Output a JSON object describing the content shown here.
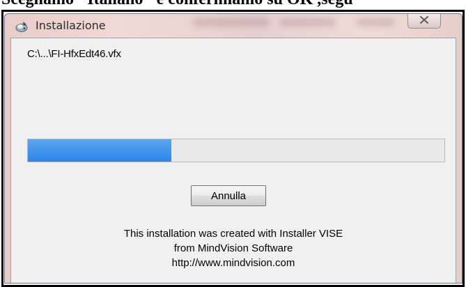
{
  "document": {
    "heading_fragment": "Scegliamo \"Italiano\" e confermiamo su OK ,segu"
  },
  "window": {
    "title": "Installazione",
    "app_icon": "installer-icon",
    "close_icon": "close-icon"
  },
  "install": {
    "current_file": "C:\\...\\FI-HfxEdt46.vfx",
    "progress_fraction": 0.345
  },
  "buttons": {
    "cancel_label": "Annulla"
  },
  "credits": {
    "line1": "This installation was created with Installer VISE",
    "line2": "from MindVision Software",
    "line3": "http://www.mindvision.com"
  },
  "colors": {
    "progress_fill": "#2f84e6",
    "title_bar_tint": "#ecd4d1",
    "client_background": "#f0f0f0"
  }
}
